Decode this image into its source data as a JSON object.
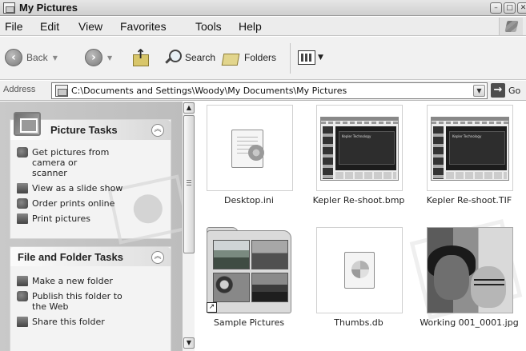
{
  "window": {
    "title": "My Pictures",
    "controls": {
      "minimize": "–",
      "maximize": "□",
      "close": "✕"
    }
  },
  "menubar": {
    "items": [
      "File",
      "Edit",
      "View",
      "Favorites",
      "Tools",
      "Help"
    ]
  },
  "toolbar": {
    "back_label": "Back",
    "search_label": "Search",
    "folders_label": "Folders"
  },
  "address": {
    "label": "Address",
    "value": "C:\\Documents and Settings\\Woody\\My Documents\\My Pictures",
    "go_label": "Go"
  },
  "taskpane": {
    "picture_tasks": {
      "title": "Picture Tasks",
      "items": [
        {
          "icon": "camera-icon",
          "label": "Get pictures from camera or scanner"
        },
        {
          "icon": "slideshow-icon",
          "label": "View as a slide show"
        },
        {
          "icon": "order-prints-icon",
          "label": "Order prints online"
        },
        {
          "icon": "printer-icon",
          "label": "Print pictures"
        }
      ]
    },
    "file_folder_tasks": {
      "title": "File and Folder Tasks",
      "items": [
        {
          "icon": "new-folder-icon",
          "label": "Make a new folder"
        },
        {
          "icon": "globe-icon",
          "label": "Publish this folder to the Web"
        },
        {
          "icon": "share-folder-icon",
          "label": "Share this folder"
        }
      ]
    }
  },
  "files": [
    {
      "name": "Desktop.ini",
      "kind": "document"
    },
    {
      "name": "Kepler Re-shoot.bmp",
      "kind": "screenshot",
      "caption": "Kepler Technology"
    },
    {
      "name": "Kepler Re-shoot.TIF",
      "kind": "screenshot",
      "caption": "Kepler Technology"
    },
    {
      "name": "Sample Pictures",
      "kind": "folder"
    },
    {
      "name": "Thumbs.db",
      "kind": "database"
    },
    {
      "name": "Working 001_0001.jpg",
      "kind": "photo"
    }
  ]
}
